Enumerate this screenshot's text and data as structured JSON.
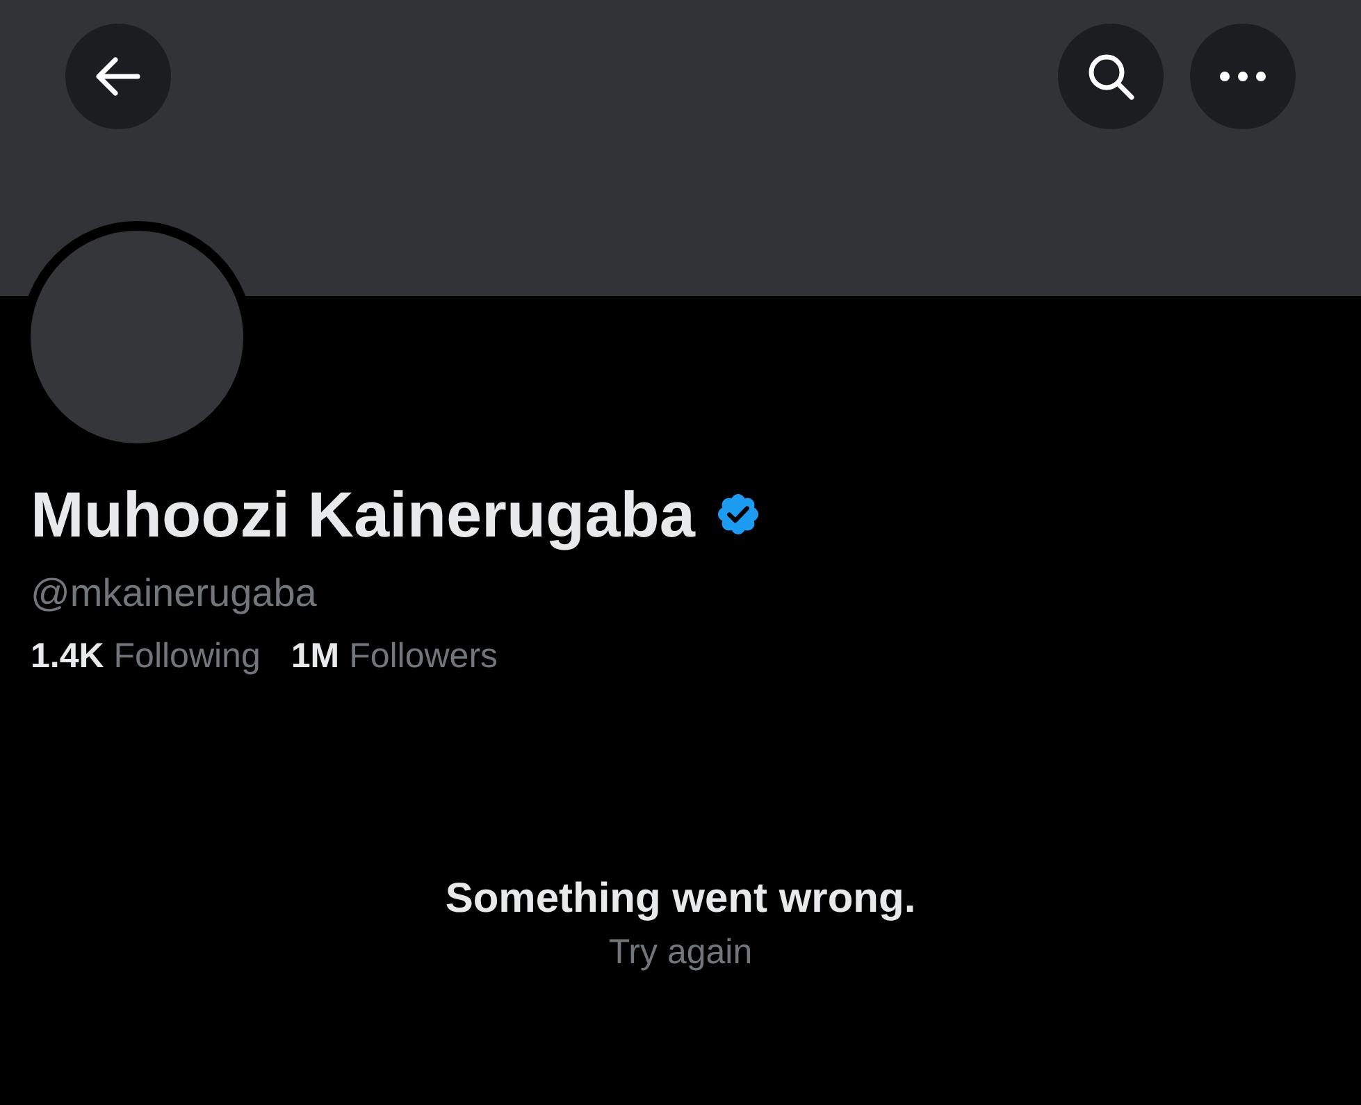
{
  "profile": {
    "name": "Muhoozi Kainerugaba",
    "verified": true,
    "handle": "@mkainerugaba",
    "stats": [
      {
        "count": "1.4K",
        "label": "Following"
      },
      {
        "count": "1M",
        "label": "Followers"
      }
    ]
  },
  "error": {
    "message": "Something went wrong.",
    "action": "Try again"
  }
}
